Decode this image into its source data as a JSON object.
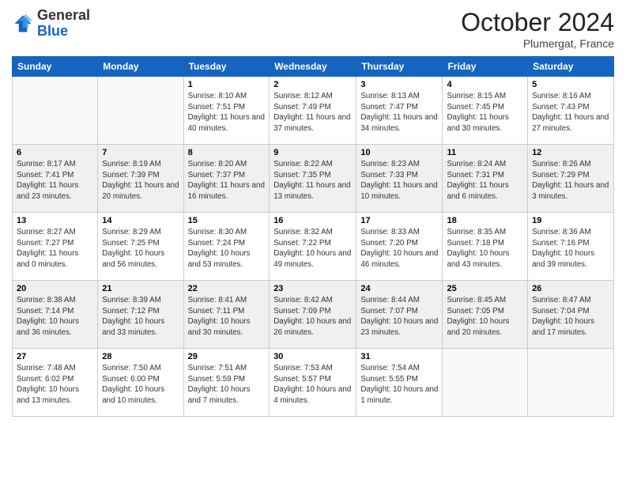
{
  "header": {
    "logo_general": "General",
    "logo_blue": "Blue",
    "month_title": "October 2024",
    "location": "Plumergat, France"
  },
  "weekdays": [
    "Sunday",
    "Monday",
    "Tuesday",
    "Wednesday",
    "Thursday",
    "Friday",
    "Saturday"
  ],
  "weeks": [
    [
      {
        "day": "",
        "sunrise": "",
        "sunset": "",
        "daylight": ""
      },
      {
        "day": "",
        "sunrise": "",
        "sunset": "",
        "daylight": ""
      },
      {
        "day": "1",
        "sunrise": "Sunrise: 8:10 AM",
        "sunset": "Sunset: 7:51 PM",
        "daylight": "Daylight: 11 hours and 40 minutes."
      },
      {
        "day": "2",
        "sunrise": "Sunrise: 8:12 AM",
        "sunset": "Sunset: 7:49 PM",
        "daylight": "Daylight: 11 hours and 37 minutes."
      },
      {
        "day": "3",
        "sunrise": "Sunrise: 8:13 AM",
        "sunset": "Sunset: 7:47 PM",
        "daylight": "Daylight: 11 hours and 34 minutes."
      },
      {
        "day": "4",
        "sunrise": "Sunrise: 8:15 AM",
        "sunset": "Sunset: 7:45 PM",
        "daylight": "Daylight: 11 hours and 30 minutes."
      },
      {
        "day": "5",
        "sunrise": "Sunrise: 8:16 AM",
        "sunset": "Sunset: 7:43 PM",
        "daylight": "Daylight: 11 hours and 27 minutes."
      }
    ],
    [
      {
        "day": "6",
        "sunrise": "Sunrise: 8:17 AM",
        "sunset": "Sunset: 7:41 PM",
        "daylight": "Daylight: 11 hours and 23 minutes."
      },
      {
        "day": "7",
        "sunrise": "Sunrise: 8:19 AM",
        "sunset": "Sunset: 7:39 PM",
        "daylight": "Daylight: 11 hours and 20 minutes."
      },
      {
        "day": "8",
        "sunrise": "Sunrise: 8:20 AM",
        "sunset": "Sunset: 7:37 PM",
        "daylight": "Daylight: 11 hours and 16 minutes."
      },
      {
        "day": "9",
        "sunrise": "Sunrise: 8:22 AM",
        "sunset": "Sunset: 7:35 PM",
        "daylight": "Daylight: 11 hours and 13 minutes."
      },
      {
        "day": "10",
        "sunrise": "Sunrise: 8:23 AM",
        "sunset": "Sunset: 7:33 PM",
        "daylight": "Daylight: 11 hours and 10 minutes."
      },
      {
        "day": "11",
        "sunrise": "Sunrise: 8:24 AM",
        "sunset": "Sunset: 7:31 PM",
        "daylight": "Daylight: 11 hours and 6 minutes."
      },
      {
        "day": "12",
        "sunrise": "Sunrise: 8:26 AM",
        "sunset": "Sunset: 7:29 PM",
        "daylight": "Daylight: 11 hours and 3 minutes."
      }
    ],
    [
      {
        "day": "13",
        "sunrise": "Sunrise: 8:27 AM",
        "sunset": "Sunset: 7:27 PM",
        "daylight": "Daylight: 11 hours and 0 minutes."
      },
      {
        "day": "14",
        "sunrise": "Sunrise: 8:29 AM",
        "sunset": "Sunset: 7:25 PM",
        "daylight": "Daylight: 10 hours and 56 minutes."
      },
      {
        "day": "15",
        "sunrise": "Sunrise: 8:30 AM",
        "sunset": "Sunset: 7:24 PM",
        "daylight": "Daylight: 10 hours and 53 minutes."
      },
      {
        "day": "16",
        "sunrise": "Sunrise: 8:32 AM",
        "sunset": "Sunset: 7:22 PM",
        "daylight": "Daylight: 10 hours and 49 minutes."
      },
      {
        "day": "17",
        "sunrise": "Sunrise: 8:33 AM",
        "sunset": "Sunset: 7:20 PM",
        "daylight": "Daylight: 10 hours and 46 minutes."
      },
      {
        "day": "18",
        "sunrise": "Sunrise: 8:35 AM",
        "sunset": "Sunset: 7:18 PM",
        "daylight": "Daylight: 10 hours and 43 minutes."
      },
      {
        "day": "19",
        "sunrise": "Sunrise: 8:36 AM",
        "sunset": "Sunset: 7:16 PM",
        "daylight": "Daylight: 10 hours and 39 minutes."
      }
    ],
    [
      {
        "day": "20",
        "sunrise": "Sunrise: 8:38 AM",
        "sunset": "Sunset: 7:14 PM",
        "daylight": "Daylight: 10 hours and 36 minutes."
      },
      {
        "day": "21",
        "sunrise": "Sunrise: 8:39 AM",
        "sunset": "Sunset: 7:12 PM",
        "daylight": "Daylight: 10 hours and 33 minutes."
      },
      {
        "day": "22",
        "sunrise": "Sunrise: 8:41 AM",
        "sunset": "Sunset: 7:11 PM",
        "daylight": "Daylight: 10 hours and 30 minutes."
      },
      {
        "day": "23",
        "sunrise": "Sunrise: 8:42 AM",
        "sunset": "Sunset: 7:09 PM",
        "daylight": "Daylight: 10 hours and 26 minutes."
      },
      {
        "day": "24",
        "sunrise": "Sunrise: 8:44 AM",
        "sunset": "Sunset: 7:07 PM",
        "daylight": "Daylight: 10 hours and 23 minutes."
      },
      {
        "day": "25",
        "sunrise": "Sunrise: 8:45 AM",
        "sunset": "Sunset: 7:05 PM",
        "daylight": "Daylight: 10 hours and 20 minutes."
      },
      {
        "day": "26",
        "sunrise": "Sunrise: 8:47 AM",
        "sunset": "Sunset: 7:04 PM",
        "daylight": "Daylight: 10 hours and 17 minutes."
      }
    ],
    [
      {
        "day": "27",
        "sunrise": "Sunrise: 7:48 AM",
        "sunset": "Sunset: 6:02 PM",
        "daylight": "Daylight: 10 hours and 13 minutes."
      },
      {
        "day": "28",
        "sunrise": "Sunrise: 7:50 AM",
        "sunset": "Sunset: 6:00 PM",
        "daylight": "Daylight: 10 hours and 10 minutes."
      },
      {
        "day": "29",
        "sunrise": "Sunrise: 7:51 AM",
        "sunset": "Sunset: 5:59 PM",
        "daylight": "Daylight: 10 hours and 7 minutes."
      },
      {
        "day": "30",
        "sunrise": "Sunrise: 7:53 AM",
        "sunset": "Sunset: 5:57 PM",
        "daylight": "Daylight: 10 hours and 4 minutes."
      },
      {
        "day": "31",
        "sunrise": "Sunrise: 7:54 AM",
        "sunset": "Sunset: 5:55 PM",
        "daylight": "Daylight: 10 hours and 1 minute."
      },
      {
        "day": "",
        "sunrise": "",
        "sunset": "",
        "daylight": ""
      },
      {
        "day": "",
        "sunrise": "",
        "sunset": "",
        "daylight": ""
      }
    ]
  ]
}
